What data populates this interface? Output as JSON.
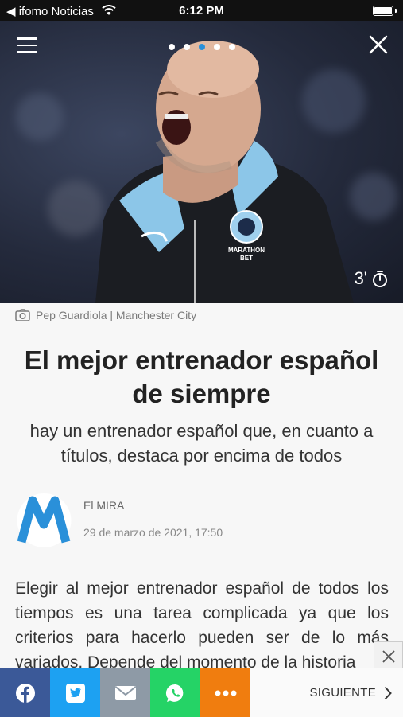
{
  "status_bar": {
    "back_label": "◀ ifomo Noticias",
    "time": "6:12 PM"
  },
  "hero": {
    "read_time": "3'",
    "active_dot": 2,
    "dot_count": 5
  },
  "caption": "Pep Guardiola | Manchester City",
  "article": {
    "title": "El mejor entrenador español de siempre",
    "subtitle": "hay un entrenador español que, en cuanto a títulos, destaca por encima de todos",
    "author": "El MIRA",
    "date": "29 de marzo de 2021, 17:50",
    "body": "Elegir al mejor entrenador español de todos los tiempos es una tarea complicada ya que los criterios para hacerlo pueden ser de lo más variados. Depende del momento de la historia"
  },
  "share_bar": {
    "next_label": "SIGUIENTE"
  },
  "colors": {
    "accent": "#2a90d9",
    "facebook": "#3b5998",
    "twitter": "#1da1f2",
    "mail": "#8e9aa6",
    "whatsapp": "#25d366",
    "more": "#f07d0f"
  },
  "icons": [
    "camera-icon",
    "stopwatch-icon",
    "menu-icon",
    "close-icon",
    "facebook-icon",
    "twitter-icon",
    "mail-icon",
    "whatsapp-icon",
    "more-icon",
    "chevron-right-icon"
  ]
}
